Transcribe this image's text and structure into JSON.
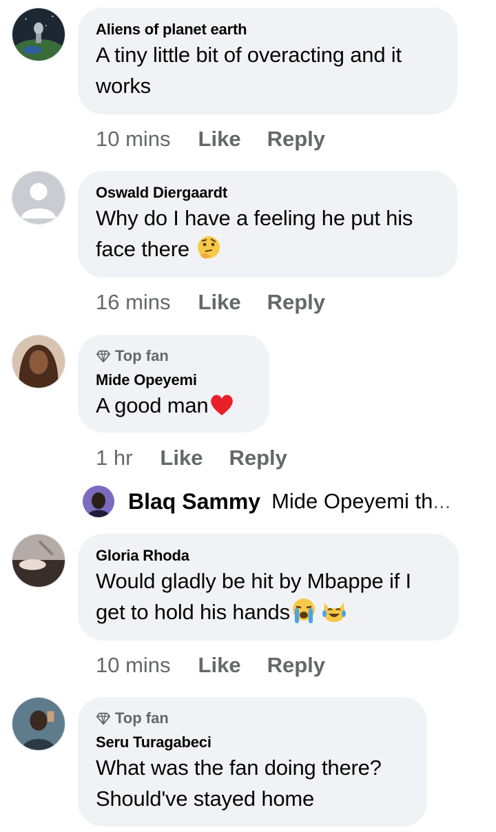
{
  "comments": [
    {
      "author": "Aliens of planet earth",
      "text_lines": [
        "A tiny little bit of overacting and it",
        "works"
      ],
      "time": "10 mins",
      "like": "Like",
      "reply": "Reply"
    },
    {
      "author": "Oswald Diergaardt",
      "text_lines": [
        "Why do I have a feeling he put his",
        "face there"
      ],
      "emojis": [
        "thinking-face"
      ],
      "time": "16 mins",
      "like": "Like",
      "reply": "Reply"
    },
    {
      "badge": "Top fan",
      "author": "Mide Opeyemi",
      "text_lines": [
        "A good man"
      ],
      "emojis": [
        "red-heart"
      ],
      "time": "1 hr",
      "like": "Like",
      "reply": "Reply"
    },
    {
      "author": "Gloria Rhoda",
      "text_lines": [
        "Would gladly be hit by Mbappe if I",
        "get to hold his hands"
      ],
      "emojis": [
        "loudly-crying-face",
        "cat-tears-of-joy"
      ],
      "time": "10 mins",
      "like": "Like",
      "reply": "Reply"
    },
    {
      "badge": "Top fan",
      "author": "Seru Turagabeci",
      "text_lines": [
        "What was the fan doing there?",
        "Should've stayed home"
      ]
    }
  ],
  "reply_preview": {
    "author": "Blaq Sammy",
    "text": "Mide Opeyemi th",
    "ellipsis": "..."
  },
  "colors": {
    "bubble": "#f0f2f5",
    "secondary_text": "#65676b",
    "primary_text": "#050505"
  }
}
